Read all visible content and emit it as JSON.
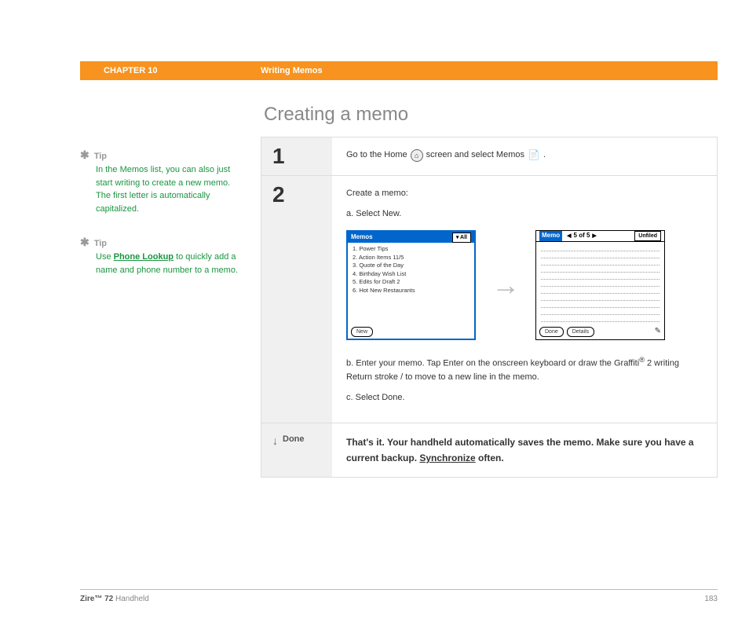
{
  "header": {
    "chapter": "CHAPTER 10",
    "title": "Writing Memos"
  },
  "page_title": "Creating a memo",
  "tips": [
    {
      "label": "Tip",
      "body": "In the Memos list, you can also just start writing to create a new memo. The first letter is automatically capitalized."
    },
    {
      "label": "Tip",
      "body_pre": "Use ",
      "link": "Phone Lookup",
      "body_post": " to quickly add a name and phone number to a memo."
    }
  ],
  "steps": {
    "s1": {
      "num": "1",
      "text_pre": "Go to the Home ",
      "text_mid": " screen and select Memos ",
      "text_post": "."
    },
    "s2": {
      "num": "2",
      "intro": "Create a memo:",
      "a": "a.  Select New.",
      "b_pre": "b.  Enter your memo. Tap Enter on the onscreen keyboard or draw the Graffiti",
      "b_sup": "®",
      "b_post": " 2 writing Return stroke  /  to move to a new line in the memo.",
      "c": "c.  Select Done."
    }
  },
  "screens": {
    "left": {
      "title": "Memos",
      "dropdown": "▾ All",
      "items": [
        "1. Power Tips",
        "2. Action Items 11/5",
        "3. Quote of the Day",
        "4. Birthday Wish List",
        "5. Edits for Draft 2",
        "6. Hot New Restaurants"
      ],
      "button": "New"
    },
    "right": {
      "title": "Memo",
      "nav": "5 of 5",
      "category": "Unfiled",
      "btn1": "Done",
      "btn2": "Details"
    }
  },
  "done": {
    "label": "Done",
    "text_pre": "That's it. Your handheld automatically saves the memo. Make sure you have a current backup. ",
    "link": "Synchronize",
    "text_post": " often."
  },
  "footer": {
    "product_bold": "Zire™ 72",
    "product_rest": " Handheld",
    "page": "183"
  }
}
